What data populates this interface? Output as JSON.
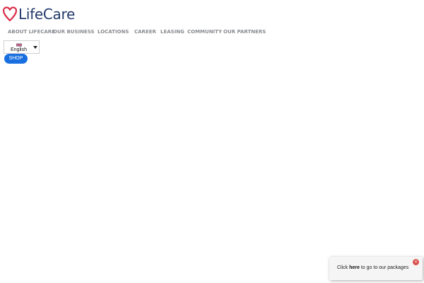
{
  "header": {
    "logo_text": "LifeCare",
    "logo_color": "#23396b",
    "heart_color": "#d9304a"
  },
  "nav": {
    "items": [
      {
        "label": "ABOUT LIFECARE"
      },
      {
        "label": "OUR BUSINESS"
      },
      {
        "label": "LOCATIONS"
      },
      {
        "label": "CAREER"
      },
      {
        "label": "LEASING"
      },
      {
        "label": "COMMUNITY"
      },
      {
        "label": "OUR PARTNERS"
      }
    ]
  },
  "language": {
    "selected": "English",
    "flag_icon": "uk-flag-icon"
  },
  "shop_button": {
    "label": "SHOP",
    "color": "#1a6fe0"
  },
  "popup": {
    "prefix": "Click ",
    "link": "here",
    "suffix": " to go to our packages",
    "close_icon": "close-icon",
    "close_glyph": "×"
  }
}
